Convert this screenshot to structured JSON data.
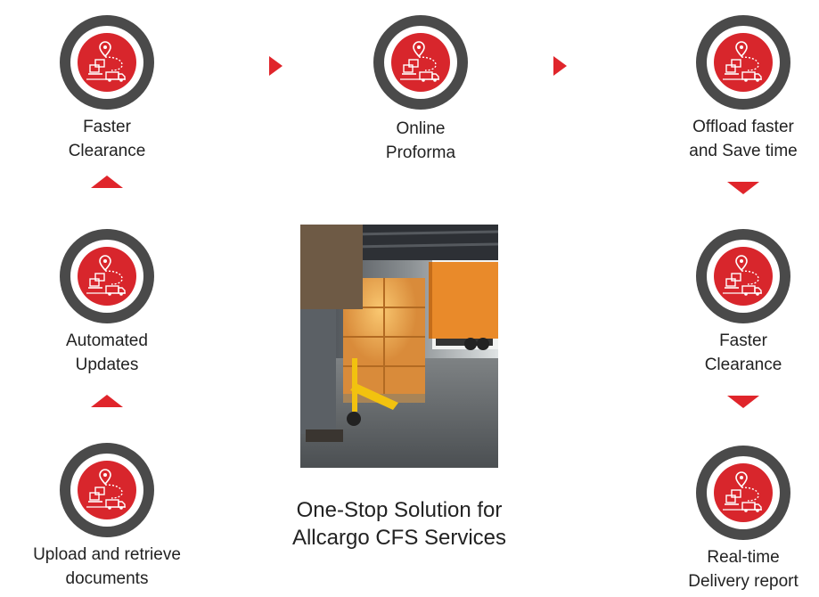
{
  "colors": {
    "accent": "#d8262c",
    "ring": "#4a4a4a",
    "text": "#222222"
  },
  "icon": "delivery-truck-location-icon",
  "steps": {
    "faster_clearance_top": {
      "line1": "Faster",
      "line2": "Clearance"
    },
    "online_proforma": {
      "line1": "Online",
      "line2": "Proforma"
    },
    "offload_faster": {
      "line1": "Offload faster",
      "line2": "and Save time"
    },
    "automated_updates": {
      "line1": "Automated",
      "line2": "Updates"
    },
    "faster_clearance_right": {
      "line1": "Faster",
      "line2": "Clearance"
    },
    "upload_documents": {
      "line1": "Upload and retrieve",
      "line2": "documents"
    },
    "realtime_delivery": {
      "line1": "Real-time",
      "line2": "Delivery report"
    }
  },
  "caption": {
    "line1": "One-Stop Solution for",
    "line2": "Allcargo CFS Services"
  }
}
